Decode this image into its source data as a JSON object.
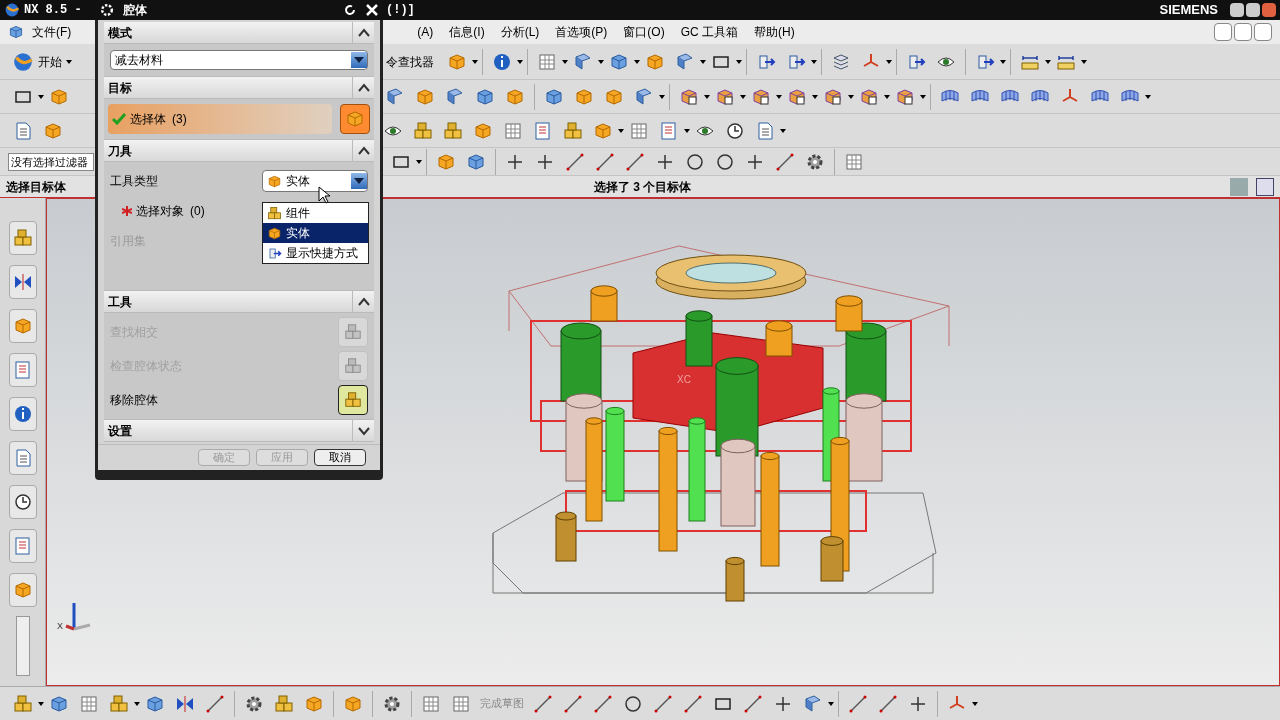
{
  "window": {
    "title": "NX 8.5 - ",
    "title_tail": "(!)]",
    "brand": "SIEMENS"
  },
  "menu": [
    "文件(F)",
    "(A)",
    "信息(I)",
    "分析(L)",
    "首选项(P)",
    "窗口(O)",
    "GC 工具箱",
    "帮助(H)"
  ],
  "toolbar": {
    "start_label": "开始",
    "command_finder": "令查找器",
    "filter_value": "没有选择过滤器",
    "finish_sketch": "完成草图"
  },
  "cue_line": {
    "prompt": "选择目标体",
    "status": "选择了 3 个目标体"
  },
  "viewport": {
    "triad_label": "X",
    "model_label": "XC"
  },
  "dialog": {
    "title": "腔体",
    "sections": [
      {
        "kind": "dropdown",
        "title": "模式",
        "expanded": true,
        "value": "减去材料"
      },
      {
        "kind": "selection",
        "title": "目标",
        "expanded": true,
        "label": "选择体",
        "count": "(3)",
        "complete": true
      },
      {
        "kind": "tool",
        "title": "刀具",
        "expanded": true,
        "type_label": "工具类型",
        "type_value": "实体",
        "select_label": "选择对象",
        "select_count": "(0)",
        "select_complete": false,
        "reference_label": "引用集",
        "options": [
          {
            "label": "组件",
            "selected": false
          },
          {
            "label": "实体",
            "selected": true
          },
          {
            "label": "显示快捷方式",
            "selected": false
          }
        ]
      },
      {
        "kind": "actions",
        "title": "工具",
        "expanded": true,
        "items": [
          {
            "label": "查找相交",
            "disabled": true
          },
          {
            "label": "检查腔体状态",
            "disabled": true
          },
          {
            "label": "移除腔体",
            "disabled": false
          }
        ]
      },
      {
        "title": "设置",
        "expanded": false
      }
    ],
    "buttons": [
      {
        "label": "确定",
        "disabled": true
      },
      {
        "label": "应用",
        "disabled": true
      },
      {
        "label": "取消",
        "disabled": false
      }
    ]
  }
}
